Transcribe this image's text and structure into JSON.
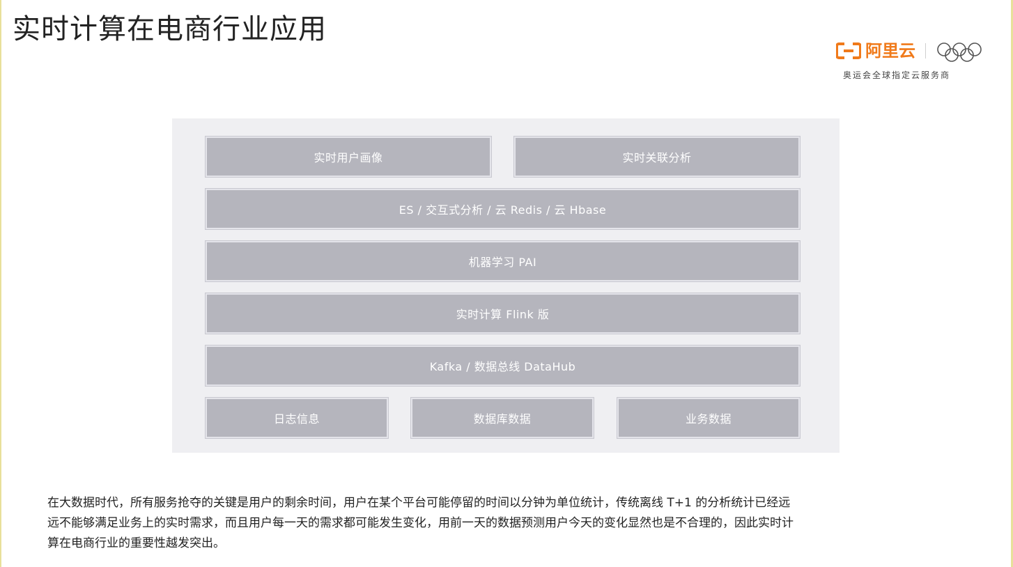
{
  "title": "实时计算在电商行业应用",
  "logo": {
    "brand": "阿里云",
    "subtitle": "奥运会全球指定云服务商",
    "brand_color": "#f07a1a",
    "icon": "olympic-rings-icon"
  },
  "diagram": {
    "layers": [
      {
        "label": "实时用户画像"
      },
      {
        "label": "实时关联分析"
      },
      {
        "label": "ES / 交互式分析 / 云 Redis / 云 Hbase"
      },
      {
        "label": "机器学习 PAI"
      },
      {
        "label": "实时计算  Flink 版"
      },
      {
        "label": "Kafka / 数据总线 DataHub"
      },
      {
        "label": "日志信息"
      },
      {
        "label": "数据库数据"
      },
      {
        "label": "业务数据"
      }
    ],
    "box_color": "#b5b5bd",
    "panel_color": "#efeff2"
  },
  "caption": {
    "line1": "在大数据时代，所有服务抢夺的关键是用户的剩余时间，用户在某个平台可能停留的时间以分钟为单位统计，传统离线 T+1 的分析统计已经远",
    "line2": "远不能够满足业务上的实时需求，而且用户每一天的需求都可能发生变化，用前一天的数据预测用户今天的变化显然也是不合理的，因此实时计",
    "line3": "算在电商行业的重要性越发突出。"
  }
}
